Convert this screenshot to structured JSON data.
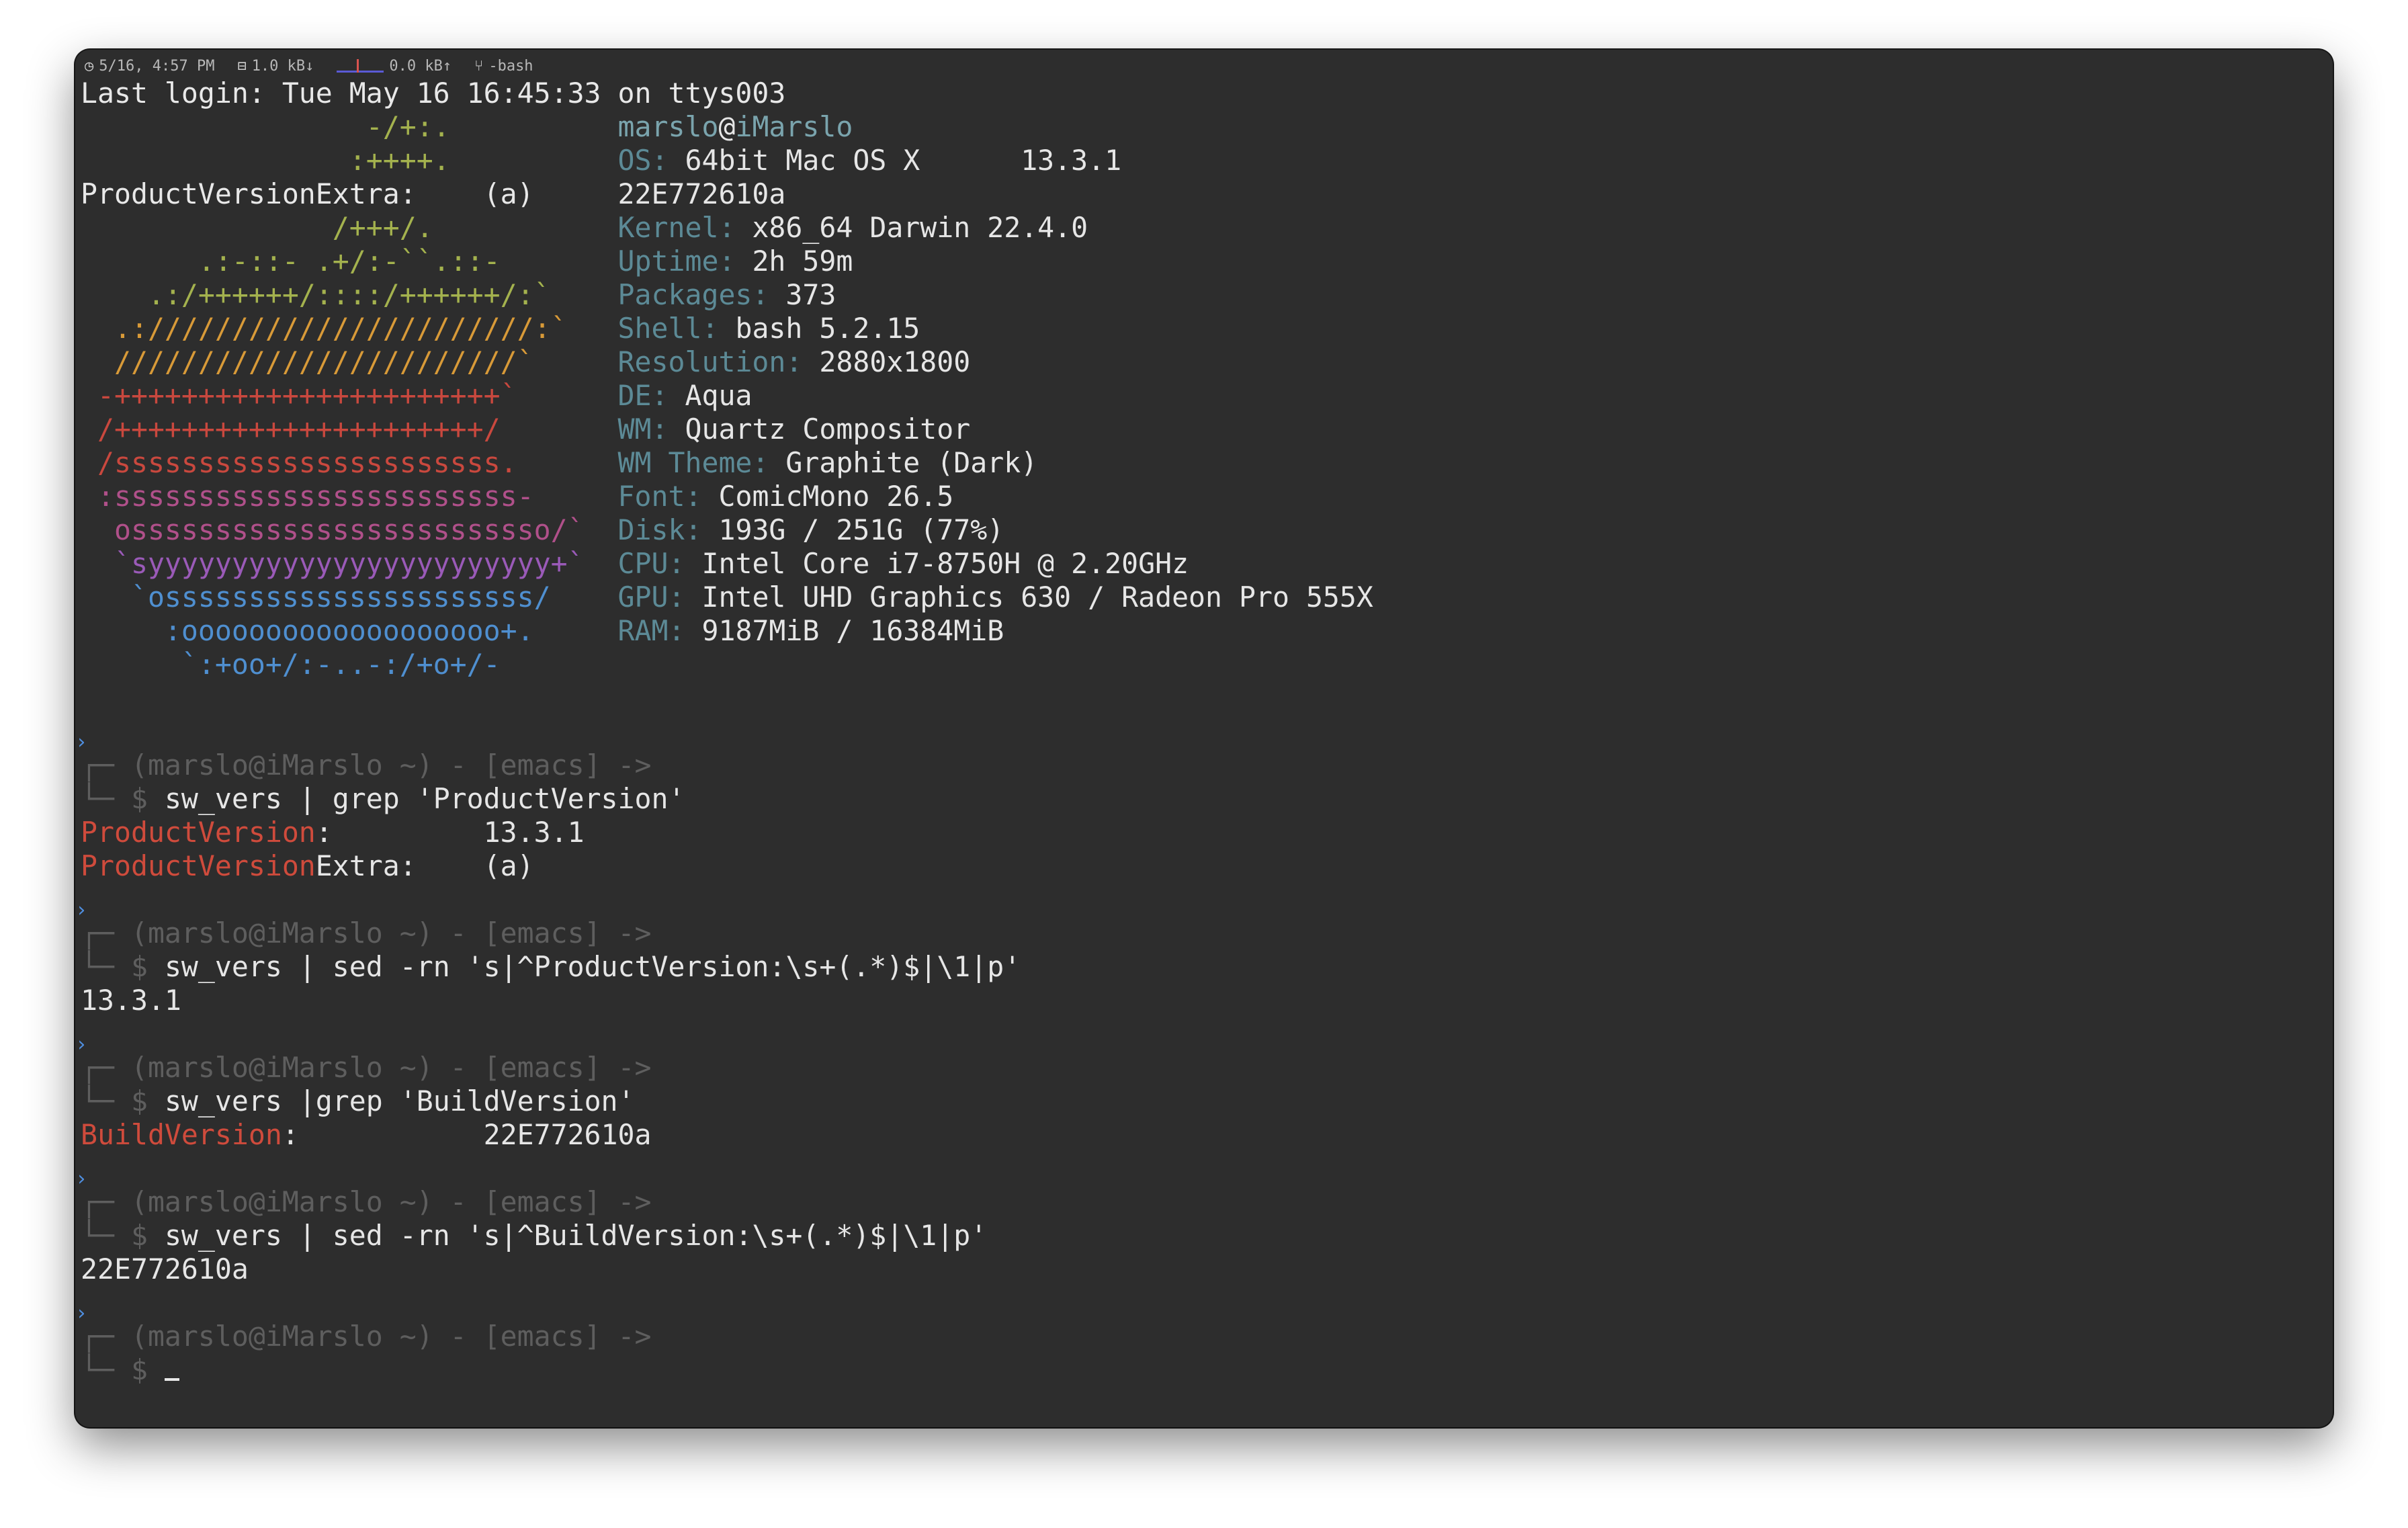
{
  "statusbar": {
    "datetime": "5/16, 4:57 PM",
    "net_down": "1.0 kB↓",
    "net_up": "0.0 kB↑",
    "process": "-bash"
  },
  "last_login": "Last login: Tue May 16 16:45:33 on ttys003",
  "neofetch": {
    "user": "marslo",
    "at": "@",
    "host": "iMarslo",
    "art": [
      {
        "text": "                 -/+:.",
        "color": "y"
      },
      {
        "text": "                :++++.",
        "color": "y"
      },
      {
        "text": "ProductVersionExtra:    (a)",
        "color": "plain"
      },
      {
        "text": "               /+++/.",
        "color": "y"
      },
      {
        "text": "       .:-::- .+/:-``.::-",
        "color": "y"
      },
      {
        "text": "    .:/++++++/::::/++++++/:`",
        "color": "y"
      },
      {
        "text": "  .:///////////////////////:`",
        "color": "o"
      },
      {
        "text": "  ////////////////////////`",
        "color": "o"
      },
      {
        "text": " -+++++++++++++++++++++++`",
        "color": "r"
      },
      {
        "text": " /++++++++++++++++++++++/",
        "color": "r"
      },
      {
        "text": " /sssssssssssssssssssssss.",
        "color": "r"
      },
      {
        "text": " :ssssssssssssssssssssssss-",
        "color": "p"
      },
      {
        "text": "  osssssssssssssssssssssssso/`",
        "color": "p"
      },
      {
        "text": "  `syyyyyyyyyyyyyyyyyyyyyyyy+`",
        "color": "v"
      },
      {
        "text": "   `ossssssssssssssssssssss/",
        "color": "b"
      },
      {
        "text": "     :ooooooooooooooooooo+.",
        "color": "b"
      },
      {
        "text": "      `:+oo+/:-..-:/+o+/-",
        "color": "b"
      }
    ],
    "info": [
      {
        "label": "OS:",
        "value": "64bit Mac OS X      13.3.1"
      },
      {
        "label": "",
        "value": "22E772610a"
      },
      {
        "label": "Kernel:",
        "value": "x86_64 Darwin 22.4.0"
      },
      {
        "label": "Uptime:",
        "value": "2h 59m"
      },
      {
        "label": "Packages:",
        "value": "373"
      },
      {
        "label": "Shell:",
        "value": "bash 5.2.15"
      },
      {
        "label": "Resolution:",
        "value": "2880x1800"
      },
      {
        "label": "DE:",
        "value": "Aqua"
      },
      {
        "label": "WM:",
        "value": "Quartz Compositor"
      },
      {
        "label": "WM Theme:",
        "value": "Graphite (Dark)"
      },
      {
        "label": "Font:",
        "value": "ComicMono 26.5"
      },
      {
        "label": "Disk:",
        "value": "193G / 251G (77%)"
      },
      {
        "label": "CPU:",
        "value": "Intel Core i7-8750H @ 2.20GHz"
      },
      {
        "label": "GPU:",
        "value": "Intel UHD Graphics 630 / Radeon Pro 555X"
      },
      {
        "label": "RAM:",
        "value": "9187MiB / 16384MiB"
      }
    ]
  },
  "prompt": {
    "context": "┌─ (marslo@iMarslo ~) - [emacs] ->",
    "symbol": "└─ $ "
  },
  "commands": [
    {
      "command": "sw_vers | grep 'ProductVersion'",
      "output": [
        {
          "hl": "ProductVersion",
          "rest": ":         13.3.1"
        },
        {
          "hl": "ProductVersion",
          "rest": "Extra:    (a)"
        }
      ]
    },
    {
      "command": "sw_vers | sed -rn 's|^ProductVersion:\\s+(.*)$|\\1|p'",
      "output": [
        {
          "hl": "",
          "rest": "13.3.1"
        }
      ]
    },
    {
      "command": "sw_vers |grep 'BuildVersion'",
      "output": [
        {
          "hl": "BuildVersion",
          "rest": ":           22E772610a"
        }
      ]
    },
    {
      "command": "sw_vers | sed -rn 's|^BuildVersion:\\s+(.*)$|\\1|p'",
      "output": [
        {
          "hl": "",
          "rest": "22E772610a"
        }
      ]
    }
  ],
  "colors": {
    "background": "#2d2d2d",
    "label": "#5c8a96",
    "highlight": "#cf4b3c",
    "dim": "#5e5e5e"
  }
}
